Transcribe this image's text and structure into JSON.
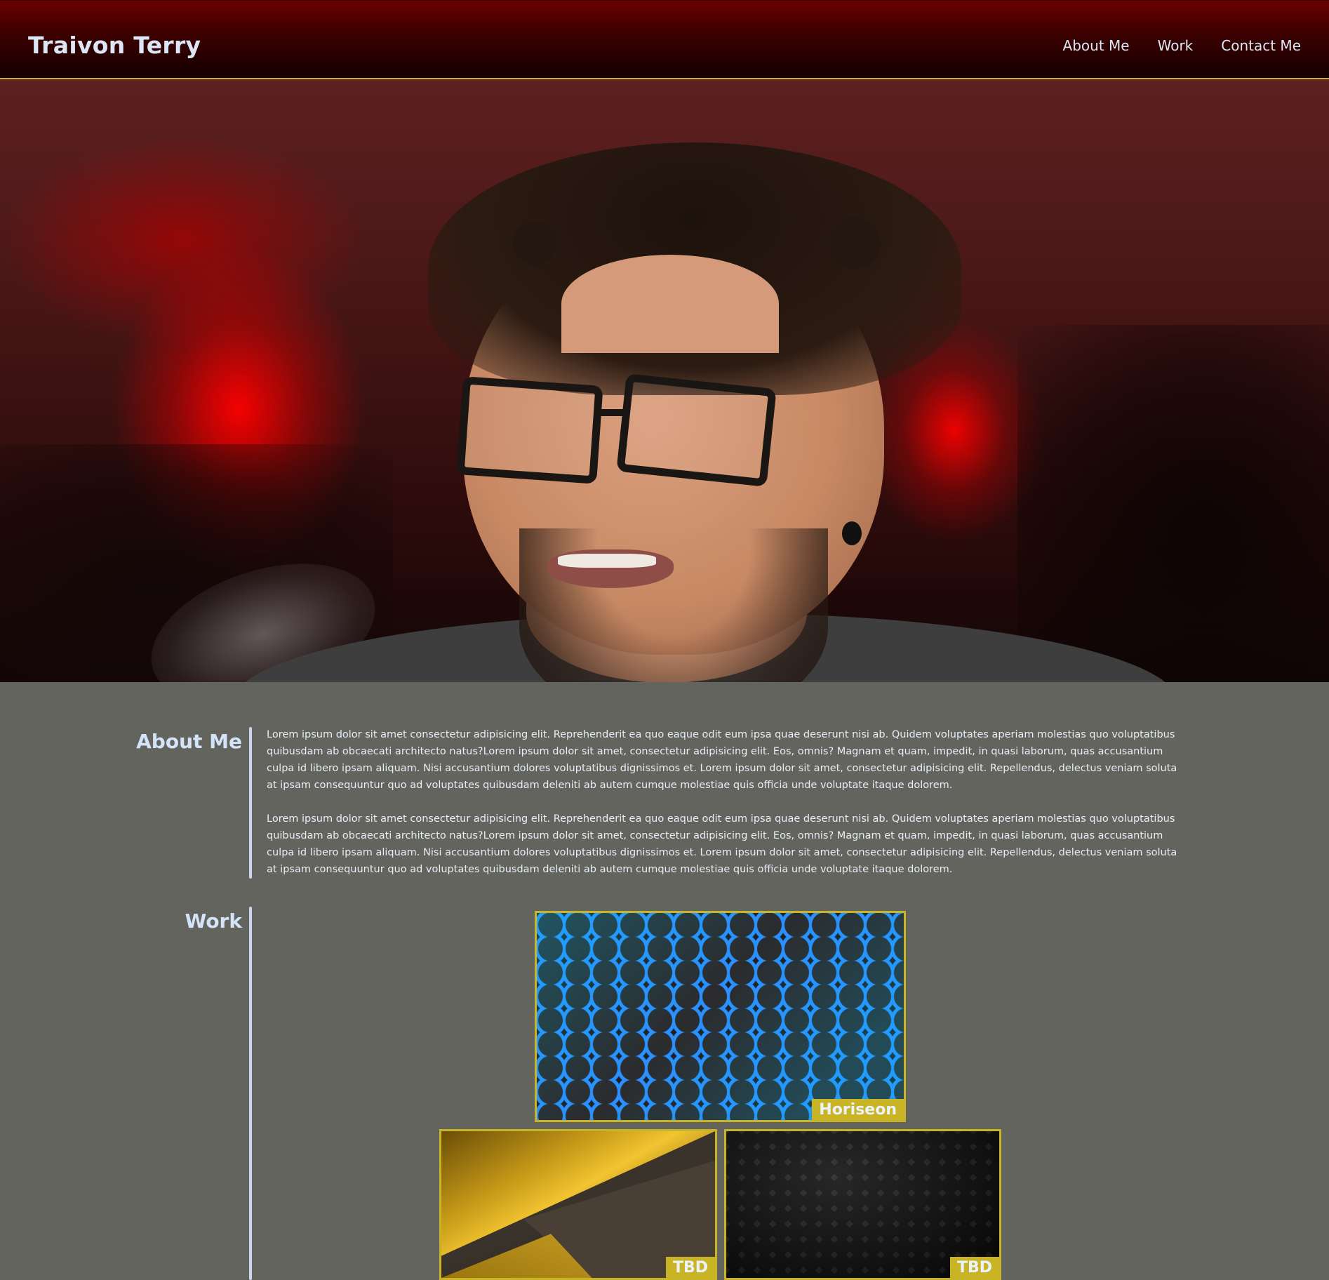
{
  "header": {
    "title": "Traivon Terry",
    "nav": [
      {
        "label": "About Me"
      },
      {
        "label": "Work"
      },
      {
        "label": "Contact Me"
      }
    ]
  },
  "hero": {
    "image": "portrait-photo"
  },
  "about": {
    "title": "About Me",
    "paragraphs": [
      "Lorem ipsum dolor sit amet consectetur adipisicing elit. Reprehenderit ea quo eaque odit eum ipsa quae deserunt nisi ab. Quidem voluptates aperiam molestias quo voluptatibus quibusdam ab obcaecati architecto natus?Lorem ipsum dolor sit amet, consectetur adipisicing elit. Eos, omnis? Magnam et quam, impedit, in quasi laborum, quas accusantium culpa id libero ipsam aliquam. Nisi accusantium dolores voluptatibus dignissimos et. Lorem ipsum dolor sit amet, consectetur adipisicing elit. Repellendus, delectus veniam soluta at ipsam consequuntur quo ad voluptates quibusdam deleniti ab autem cumque molestiae quis officia unde voluptate itaque dolorem.",
      "Lorem ipsum dolor sit amet consectetur adipisicing elit. Reprehenderit ea quo eaque odit eum ipsa quae deserunt nisi ab. Quidem voluptates aperiam molestias quo voluptatibus quibusdam ab obcaecati architecto natus?Lorem ipsum dolor sit amet, consectetur adipisicing elit. Eos, omnis? Magnam et quam, impedit, in quasi laborum, quas accusantium culpa id libero ipsam aliquam. Nisi accusantium dolores voluptatibus dignissimos et. Lorem ipsum dolor sit amet, consectetur adipisicing elit. Repellendus, delectus veniam soluta at ipsam consequuntur quo ad voluptates quibusdam deleniti ab autem cumque molestiae quis officia unde voluptate itaque dolorem."
    ]
  },
  "work": {
    "title": "Work",
    "projects": [
      {
        "label": "Horiseon",
        "image": "blue-hexagon-pattern"
      },
      {
        "label": "TBD",
        "image": "gold-abstract-pattern"
      },
      {
        "label": "TBD",
        "image": "dark-diamond-mesh-pattern"
      }
    ]
  },
  "colors": {
    "header_bg": "#6a0000",
    "accent": "#c9b426",
    "body_bg": "#63645e",
    "text": "#dce6f5"
  }
}
